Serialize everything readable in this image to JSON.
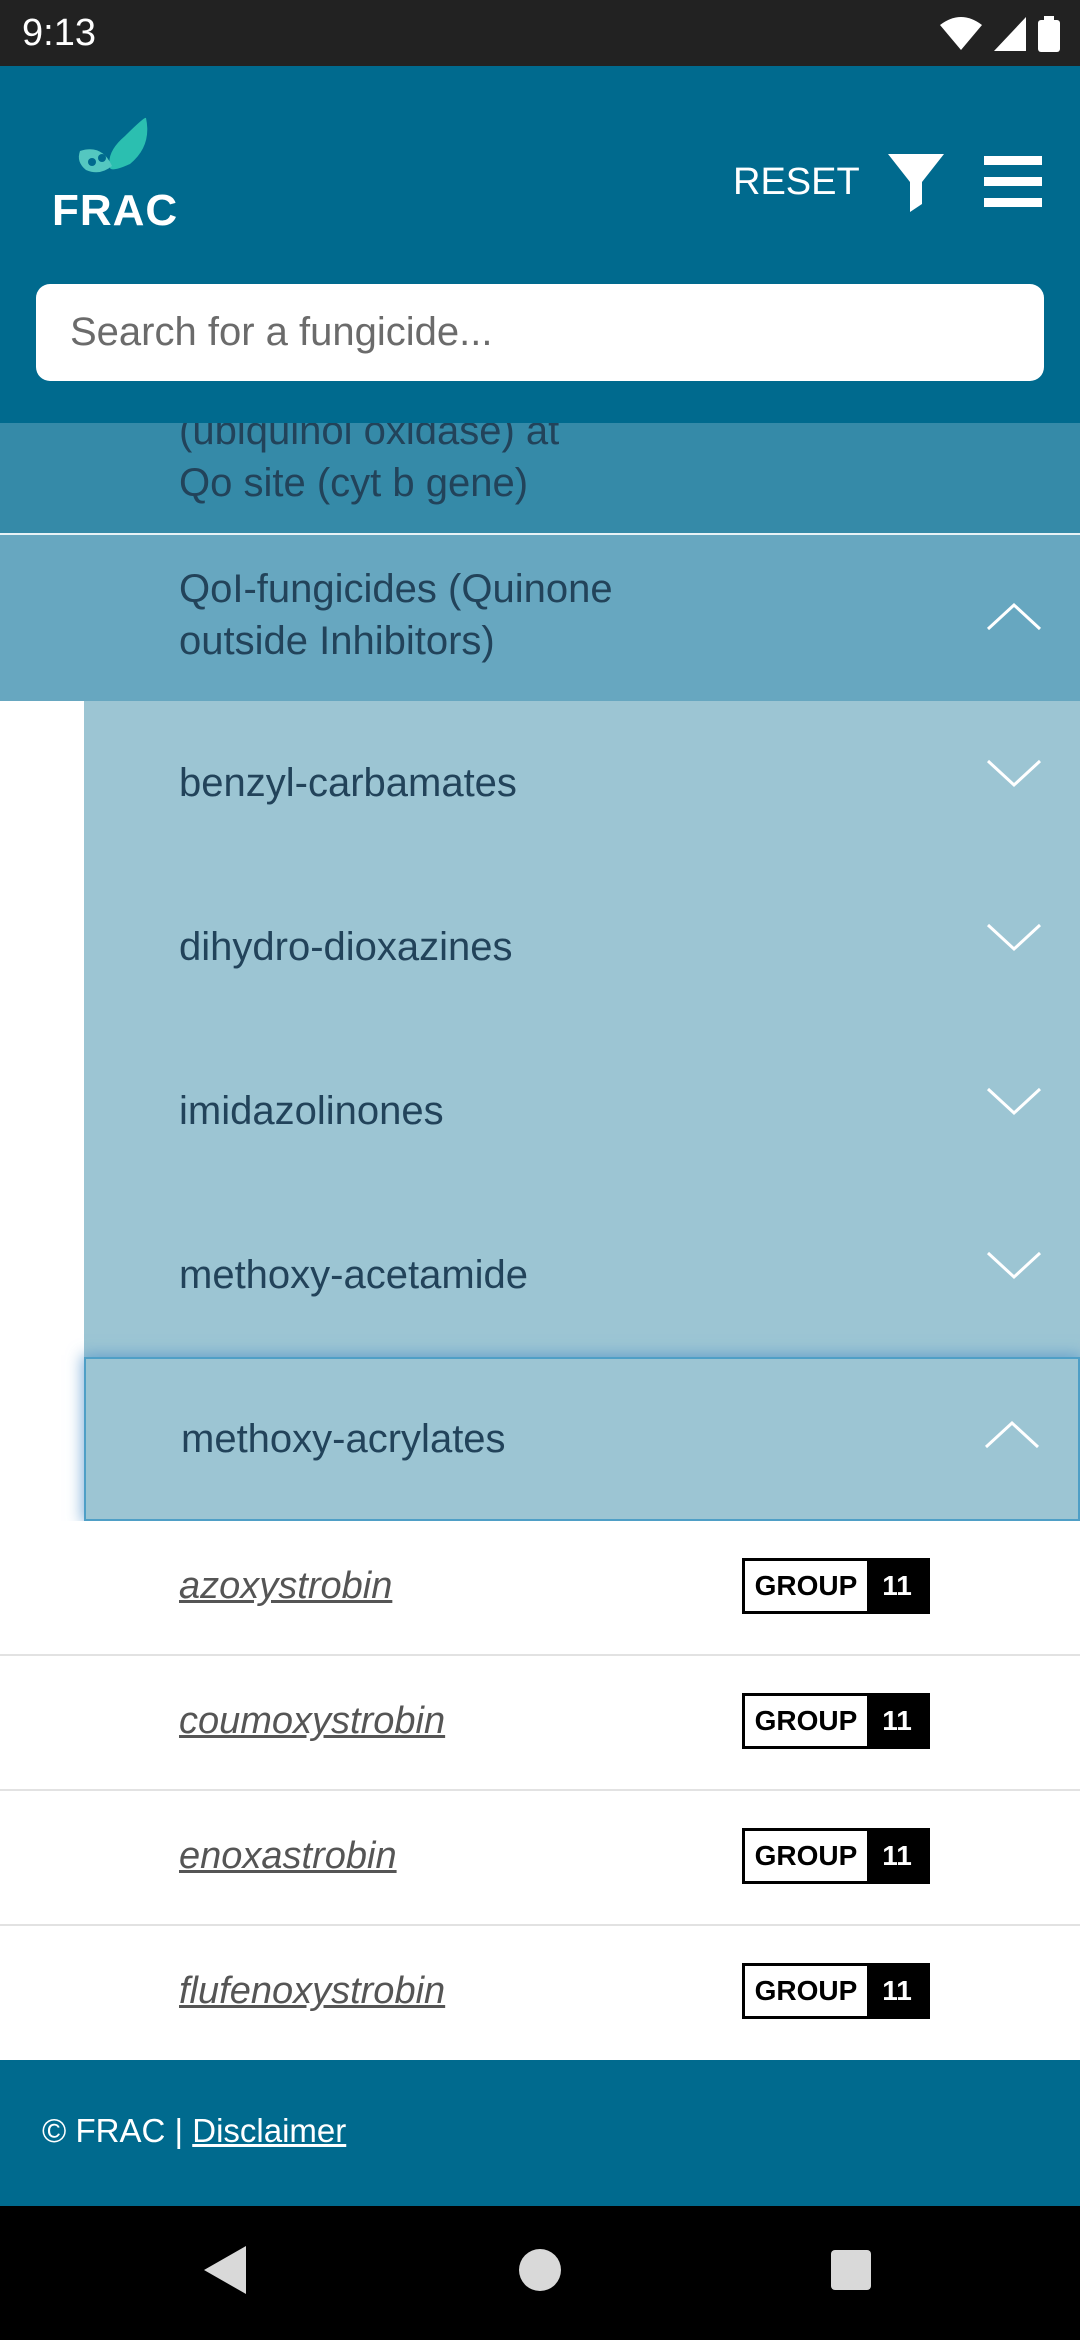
{
  "status_bar": {
    "time": "9:13"
  },
  "header": {
    "logo_text": "FRAC",
    "reset_label": "RESET",
    "search_placeholder": "Search for a fungicide..."
  },
  "tree": {
    "parent_partial": {
      "line1": "(ubiquinol oxidase) at",
      "line2": "Qo site (cyt b gene)"
    },
    "group": {
      "line1": "QoI-fungicides (Quinone",
      "line2": "outside Inhibitors)"
    },
    "subgroups": [
      {
        "label": "benzyl-carbamates"
      },
      {
        "label": "dihydro-dioxazines"
      },
      {
        "label": "imidazolinones"
      },
      {
        "label": "methoxy-acetamide"
      },
      {
        "label": "methoxy-acrylates"
      }
    ],
    "items": [
      {
        "name": "azoxystrobin",
        "badge_label": "GROUP",
        "badge_number": "11"
      },
      {
        "name": "coumoxystrobin",
        "badge_label": "GROUP",
        "badge_number": "11"
      },
      {
        "name": "enoxastrobin",
        "badge_label": "GROUP",
        "badge_number": "11"
      },
      {
        "name": "flufenoxystrobin",
        "badge_label": "GROUP",
        "badge_number": "11"
      }
    ]
  },
  "footer": {
    "copyright": "© FRAC |",
    "disclaimer": "Disclaimer"
  }
}
